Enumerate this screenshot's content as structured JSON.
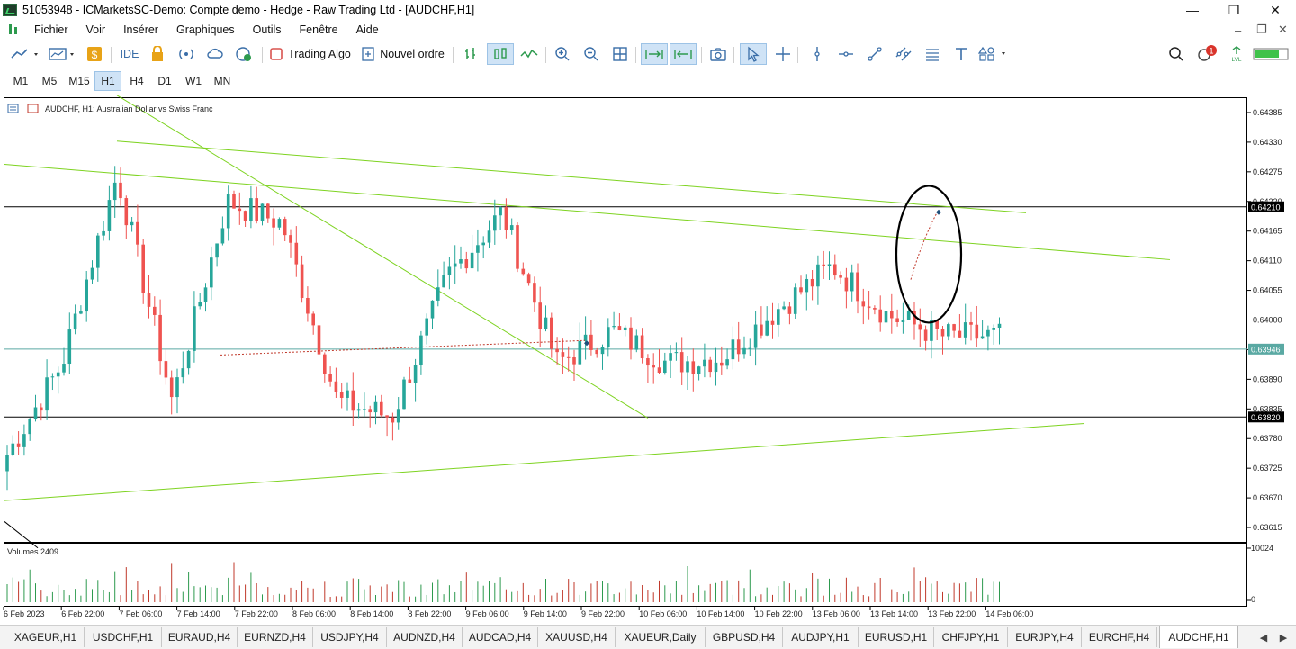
{
  "window": {
    "title": "51053948 - ICMarketsSC-Demo: Compte demo - Hedge - Raw Trading Ltd - [AUDCHF,H1]",
    "minimize": "—",
    "restore": "❐",
    "close": "✕",
    "inner_minimize": "–",
    "inner_restore": "❐",
    "inner_close": "✕"
  },
  "menu": [
    "Fichier",
    "Voir",
    "Insérer",
    "Graphiques",
    "Outils",
    "Fenêtre",
    "Aide"
  ],
  "toolbar": {
    "ide_label": "IDE",
    "algo_label": "Trading Algo",
    "order_label": "Nouvel ordre",
    "notification_count": "1",
    "signal_label": "LVL"
  },
  "timeframes": [
    "M1",
    "M5",
    "M15",
    "H1",
    "H4",
    "D1",
    "W1",
    "MN"
  ],
  "active_timeframe": "H1",
  "chart": {
    "header": "AUDCHF, H1:  Australian Dollar vs Swiss Franc",
    "volume_label": "Volumes 2409",
    "price_ticks": [
      "0.64385",
      "0.64330",
      "0.64275",
      "0.64220",
      "0.64165",
      "0.64110",
      "0.64055",
      "0.64000",
      "0.63945",
      "0.63890",
      "0.63835",
      "0.63780",
      "0.63725",
      "0.63670",
      "0.63615"
    ],
    "volume_ticks": [
      "10024",
      "0"
    ],
    "time_labels": [
      "6 Feb 2023",
      "6 Feb 22:00",
      "7 Feb 06:00",
      "7 Feb 14:00",
      "7 Feb 22:00",
      "8 Feb 06:00",
      "8 Feb 14:00",
      "8 Feb 22:00",
      "9 Feb 06:00",
      "9 Feb 14:00",
      "9 Feb 22:00",
      "10 Feb 06:00",
      "10 Feb 14:00",
      "10 Feb 22:00",
      "13 Feb 06:00",
      "13 Feb 14:00",
      "13 Feb 22:00",
      "14 Feb 06:00"
    ],
    "hline_labels": {
      "upper": "0.64210",
      "current": "0.63946",
      "lower": "0.63820"
    },
    "colors": {
      "bull": "#26a69a",
      "bear": "#ef5350",
      "trend": "#7ed321",
      "hline": "#000000",
      "current_line": "#5aa9a3"
    }
  },
  "chart_data": {
    "type": "candlestick",
    "symbol": "AUDCHF",
    "timeframe": "H1",
    "ylim": [
      0.6359,
      0.6441
    ],
    "horizontal_levels": [
      0.6421,
      0.63946,
      0.6382
    ],
    "x": [
      "6 Feb 2023",
      "6 Feb 22:00",
      "7 Feb 06:00",
      "7 Feb 14:00",
      "7 Feb 22:00",
      "8 Feb 06:00",
      "8 Feb 14:00",
      "8 Feb 22:00",
      "9 Feb 06:00",
      "9 Feb 14:00",
      "9 Feb 22:00",
      "10 Feb 06:00",
      "10 Feb 14:00",
      "10 Feb 22:00",
      "13 Feb 06:00",
      "13 Feb 14:00",
      "13 Feb 22:00",
      "14 Feb 06:00"
    ],
    "close_anchors": [
      0.6375,
      0.6392,
      0.6427,
      0.6385,
      0.6422,
      0.6418,
      0.6385,
      0.6382,
      0.6408,
      0.642,
      0.6392,
      0.6398,
      0.6392,
      0.6393,
      0.6402,
      0.641,
      0.6401,
      0.6397
    ]
  },
  "tabs": [
    "XAGEUR,H1",
    "USDCHF,H1",
    "EURAUD,H4",
    "EURNZD,H4",
    "USDJPY,H4",
    "AUDNZD,H4",
    "AUDCAD,H4",
    "XAUUSD,H4",
    "XAUEUR,Daily",
    "GBPUSD,H4",
    "AUDJPY,H1",
    "EURUSD,H1",
    "CHFJPY,H1",
    "EURJPY,H4",
    "EURCHF,H4",
    "AUDCHF,H1"
  ],
  "active_tab": "AUDCHF,H1",
  "tab_scroll_left": "◀",
  "tab_scroll_right": "▶"
}
